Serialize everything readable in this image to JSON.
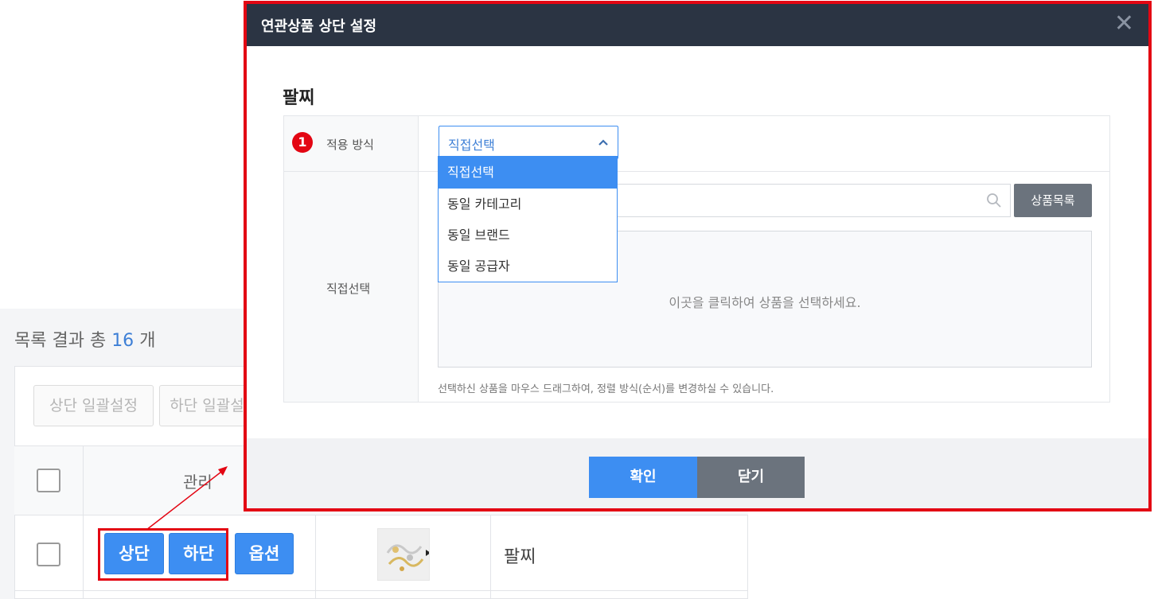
{
  "background_page": {
    "summary": {
      "prefix": "목록 결과 총",
      "count": "16",
      "suffix": "개"
    },
    "batch_buttons": {
      "top_batch": "상단 일괄설정",
      "bottom_batch": "하단 일괄설"
    },
    "table_header": {
      "manage": "관리"
    },
    "row": {
      "top_button": "상단",
      "bottom_button": "하단",
      "option_button": "옵션",
      "product_name": "팔찌"
    }
  },
  "modal": {
    "title": "연관상품 상단 설정",
    "section_title": "팔찌",
    "step_badge": "1",
    "apply_method_label": "적용 방식",
    "select_value": "직접선택",
    "dropdown_options": [
      "직접선택",
      "동일 카테고리",
      "동일 브랜드",
      "동일 공급자"
    ],
    "selected_option": "직접선택",
    "direct_select_label": "직접선택",
    "product_list_button": "상품목록",
    "drop_area_text": "이곳을 클릭하여 상품을 선택하세요.",
    "help_text": "선택하신 상품을 마우스 드래그하여, 정렬 방식(순서)를 변경하실 수 있습니다.",
    "confirm_button": "확인",
    "close_button": "닫기"
  },
  "colors": {
    "accent_blue": "#3d8ef2",
    "header_dark": "#2b3443",
    "highlight_red": "#e30613",
    "gray_button": "#6b737d"
  },
  "icons": [
    "close-icon",
    "chevron-up-icon",
    "search-icon",
    "checkbox-icon",
    "arrow-pointer"
  ]
}
